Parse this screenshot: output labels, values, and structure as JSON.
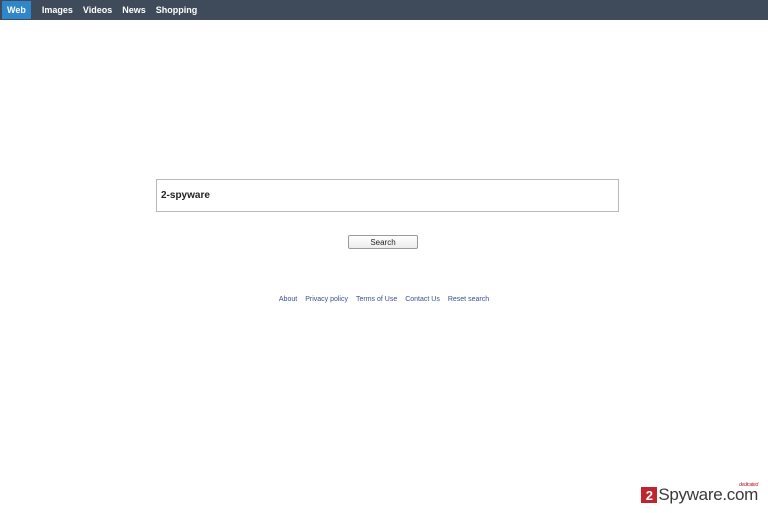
{
  "nav": {
    "tabs": [
      {
        "label": "Web",
        "active": true
      },
      {
        "label": "Images",
        "active": false
      },
      {
        "label": "Videos",
        "active": false
      },
      {
        "label": "News",
        "active": false
      },
      {
        "label": "Shopping",
        "active": false
      }
    ]
  },
  "search": {
    "value": "2-spyware",
    "button_label": "Search"
  },
  "footer": {
    "links": [
      "About",
      "Privacy policy",
      "Terms of Use",
      "Contact Us",
      "Reset search"
    ]
  },
  "watermark": {
    "mark": "2",
    "text": "Spyware.com",
    "sub": "dedicated"
  },
  "colors": {
    "topbar": "#3f4b5a",
    "active_tab": "#2f86c9",
    "link": "#3b4f8f"
  }
}
